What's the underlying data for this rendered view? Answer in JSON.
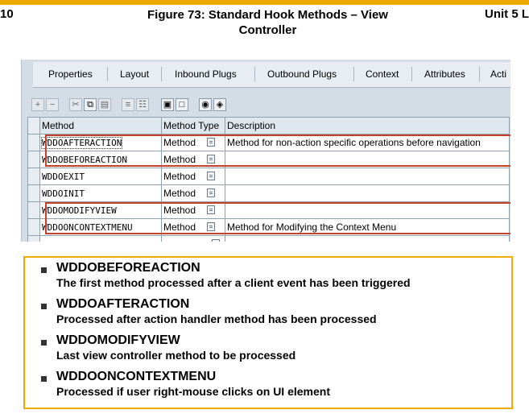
{
  "header": {
    "left_fragment": "10",
    "title_line1": "Figure 73: Standard Hook Methods – View",
    "title_line2": "Controller",
    "right_label": "Unit 5 L"
  },
  "tabs": [
    "Properties",
    "Layout",
    "Inbound Plugs",
    "Outbound Plugs",
    "Context",
    "Attributes",
    "Acti"
  ],
  "toolbar_icons": [
    "insert-row-icon",
    "delete-row-icon",
    "cut-icon",
    "copy-icon",
    "paste-icon",
    "detail-icon",
    "details-icon",
    "select-all-icon",
    "deselect-icon",
    "find-icon",
    "find-next-icon"
  ],
  "table": {
    "columns": [
      "Method",
      "Method Type",
      "Description"
    ],
    "rows": [
      {
        "method": "WDDOAFTERACTION",
        "type": "Method",
        "description": "Method for non-action specific operations before navigation"
      },
      {
        "method": "WDDOBEFOREACTION",
        "type": "Method",
        "description": ""
      },
      {
        "method": "WDDOEXIT",
        "type": "Method",
        "description": ""
      },
      {
        "method": "WDDOINIT",
        "type": "Method",
        "description": ""
      },
      {
        "method": "WDDOMODIFYVIEW",
        "type": "Method",
        "description": ""
      },
      {
        "method": "WDDOONCONTEXTMENU",
        "type": "Method",
        "description": "Method for Modifying the Context Menu"
      },
      {
        "method": "",
        "type": "",
        "description": ""
      }
    ]
  },
  "bullets": [
    {
      "title": "WDDOBEFOREACTION",
      "desc": "The first method processed after a client event has been triggered"
    },
    {
      "title": "WDDOAFTERACTION",
      "desc": "Processed after action handler method has been processed"
    },
    {
      "title": "WDDOMODIFYVIEW",
      "desc": "Last view controller method to be processed"
    },
    {
      "title": "WDDOONCONTEXTMENU",
      "desc": "Processed if user right-mouse clicks on UI element"
    }
  ],
  "colors": {
    "accent_bar": "#f0ab00",
    "highlight": "#c6402b",
    "panel_bg": "#d4dde5"
  }
}
